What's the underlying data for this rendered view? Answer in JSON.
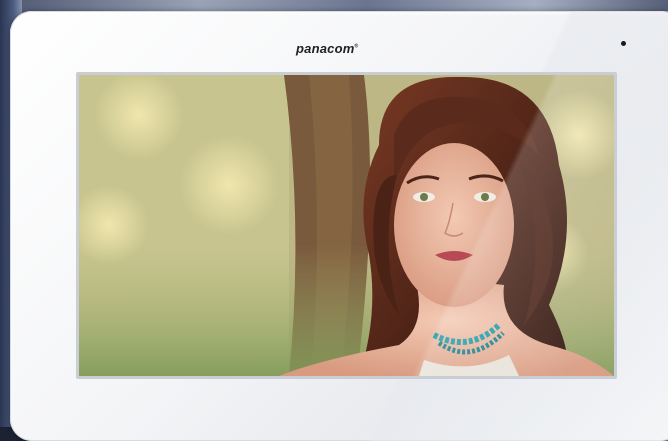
{
  "device": {
    "brand": "panacom",
    "trademark": "®"
  },
  "screen": {
    "content": "portrait-photo"
  },
  "colors": {
    "body": "#f4f5f7",
    "bezel": "#c9cdd4",
    "hair": "#5a2a1c",
    "skin": "#e9b9a2",
    "lips": "#b84a55",
    "necklace": "#1f9aa8",
    "foliage": "#c7c38d",
    "trunk": "#6e4f34"
  }
}
